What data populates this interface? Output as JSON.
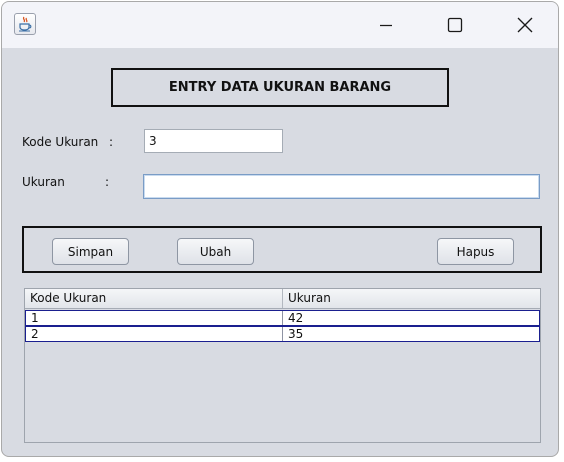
{
  "window": {
    "icon": "java-cup-icon",
    "controls": {
      "minimize_icon": "minimize-icon",
      "maximize_icon": "maximize-icon",
      "close_icon": "close-icon"
    }
  },
  "form": {
    "title": "ENTRY DATA UKURAN BARANG",
    "kode_label": "Kode Ukuran",
    "kode_colon": ":",
    "kode_value": "3",
    "ukuran_label": "Ukuran",
    "ukuran_colon": ":",
    "ukuran_value": ""
  },
  "buttons": {
    "simpan": "Simpan",
    "ubah": "Ubah",
    "hapus": "Hapus"
  },
  "table": {
    "columns": [
      "Kode Ukuran",
      "Ukuran"
    ],
    "rows": [
      [
        "1",
        "42"
      ],
      [
        "2",
        "35"
      ]
    ]
  },
  "colors": {
    "background": "#d8dbe2",
    "row_border": "#1a1f8f"
  }
}
